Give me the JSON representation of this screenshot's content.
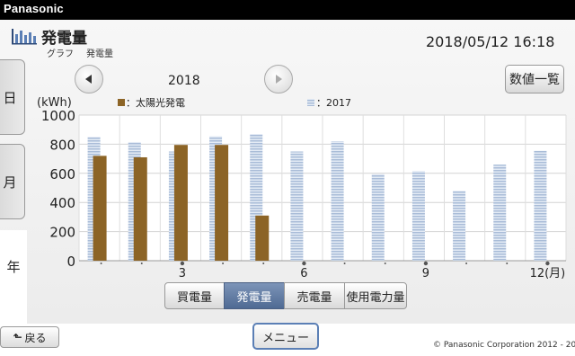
{
  "app": {
    "brand": "Panasonic"
  },
  "header": {
    "title": "発電量",
    "breadcrumb": [
      "グラフ",
      "発電量"
    ],
    "datetime": "2018/05/12  16:18"
  },
  "period_tabs": {
    "day": "日",
    "month": "月",
    "year": "年"
  },
  "nav": {
    "year": "2018"
  },
  "buttons": {
    "numeric_list": "数値一覧",
    "back": "戻る",
    "menu": "メニュー"
  },
  "bottom_tabs": [
    {
      "label": "買電量",
      "active": false
    },
    {
      "label": "発電量",
      "active": true
    },
    {
      "label": "売電量",
      "active": false
    },
    {
      "label": "使用電力量",
      "active": false
    }
  ],
  "footer": {
    "copyright": "© Panasonic Corporation 2012 - 201"
  },
  "colors": {
    "current": "#8c6426",
    "previous": "#a9bcd8",
    "topbar": "#000000",
    "active_tab": "#5f7aa3"
  },
  "icons": [
    "bar-chart-icon",
    "chevron-left-icon",
    "chevron-right-icon",
    "back-arrow-icon"
  ],
  "chart_data": {
    "type": "bar",
    "ylabel": "(kWh)",
    "xlabel": "",
    "ylim": [
      0,
      1000
    ],
    "yticks": [
      0,
      200,
      400,
      600,
      800,
      1000
    ],
    "categories": [
      1,
      2,
      3,
      4,
      5,
      6,
      7,
      8,
      9,
      10,
      11,
      12
    ],
    "xtick_labels": {
      "3": "3",
      "6": "6",
      "9": "9",
      "12": "12(月)"
    },
    "grid": true,
    "legend_placement": "top",
    "series": [
      {
        "name": "：太陽光発電",
        "style": "solid",
        "values": [
          720,
          710,
          795,
          795,
          310,
          null,
          null,
          null,
          null,
          null,
          null,
          null
        ]
      },
      {
        "name": "：2017",
        "style": "striped",
        "values": [
          850,
          815,
          750,
          855,
          870,
          750,
          820,
          595,
          615,
          480,
          660,
          755
        ]
      }
    ]
  }
}
